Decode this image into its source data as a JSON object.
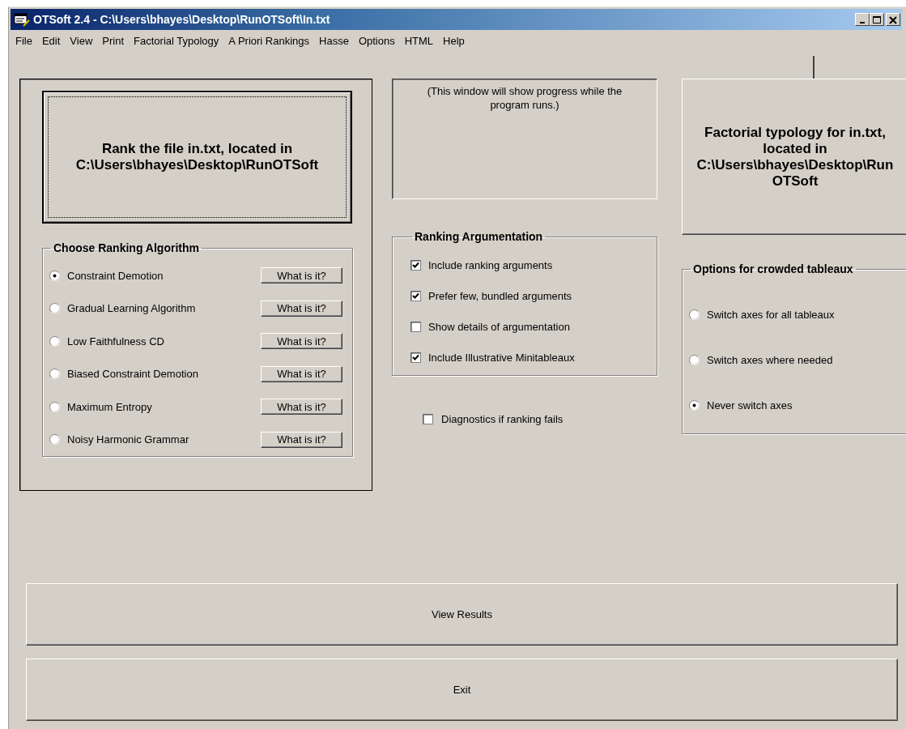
{
  "window": {
    "title": "OTSoft 2.4 - C:\\Users\\bhayes\\Desktop\\RunOTSoft\\In.txt"
  },
  "menu": [
    "File",
    "Edit",
    "View",
    "Print",
    "Factorial Typology",
    "A Priori Rankings",
    "Hasse",
    "Options",
    "HTML",
    "Help"
  ],
  "rank_button": "Rank the file in.txt, located in C:\\Users\\bhayes\\Desktop\\RunOTSoft",
  "algorithm_group": {
    "title": "Choose Ranking Algorithm",
    "options": [
      {
        "label": "Constraint Demotion",
        "selected": true,
        "help_button": "What is it?"
      },
      {
        "label": "Gradual Learning Algorithm",
        "selected": false,
        "help_button": "What is it?"
      },
      {
        "label": "Low Faithfulness CD",
        "selected": false,
        "help_button": "What is it?"
      },
      {
        "label": "Biased Constraint Demotion",
        "selected": false,
        "help_button": "What is it?"
      },
      {
        "label": "Maximum Entropy",
        "selected": false,
        "help_button": "What is it?"
      },
      {
        "label": "Noisy Harmonic Grammar",
        "selected": false,
        "help_button": "What is it?"
      }
    ]
  },
  "progress_box": {
    "text": "(This window will show progress while the program runs.)"
  },
  "argumentation_group": {
    "title": "Ranking Argumentation",
    "options": [
      {
        "label": "Include ranking arguments",
        "checked": true
      },
      {
        "label": "Prefer few, bundled arguments",
        "checked": true
      },
      {
        "label": "Show details of argumentation",
        "checked": false
      },
      {
        "label": "Include Illustrative Minitableaux",
        "checked": true
      }
    ]
  },
  "diagnostics": {
    "label": "Diagnostics if ranking fails",
    "checked": false
  },
  "factorial_button": "Factorial typology for in.txt, located in C:\\Users\\bhayes\\Desktop\\RunOTSoft",
  "tableaux_group": {
    "title": "Options for crowded tableaux",
    "options": [
      {
        "label": "Switch axes for all tableaux",
        "selected": false
      },
      {
        "label": "Switch axes where needed",
        "selected": false
      },
      {
        "label": "Never switch axes",
        "selected": true
      }
    ]
  },
  "view_results_button": "View Results",
  "exit_button": "Exit"
}
